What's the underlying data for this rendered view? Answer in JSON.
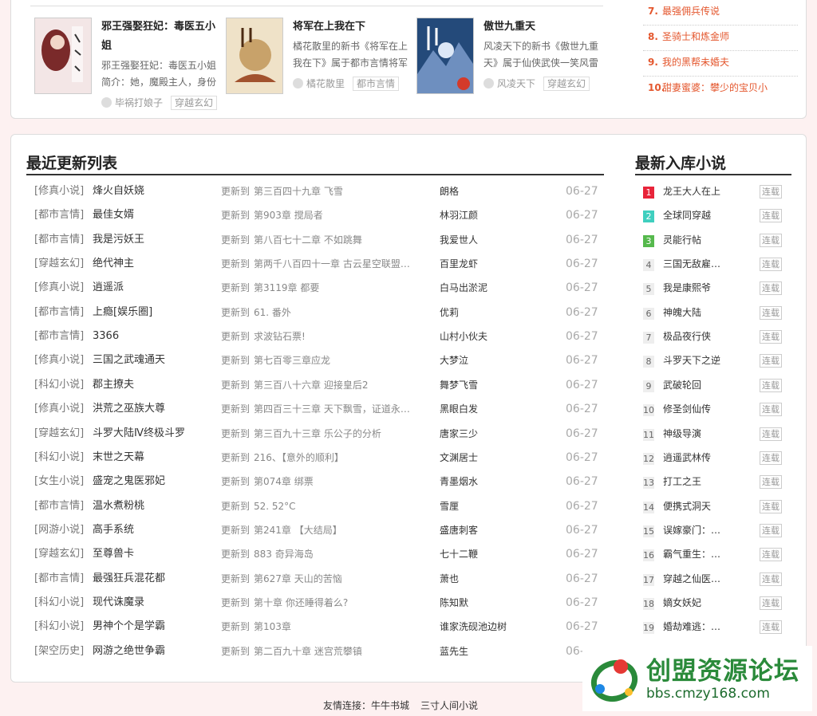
{
  "featured_books": [
    {
      "title": "邪王强娶狂妃：毒医五小姐",
      "desc": "邪王强娶狂妃：毒医五小姐简介：她，魔殿主人，身份",
      "author": "毕祸打娘子",
      "tag": "穿越玄幻"
    },
    {
      "title": "将军在上我在下",
      "desc": "橘花散里的新书《将军在上我在下》属于都市言情将军",
      "author": "橘花散里",
      "tag": "都市言情"
    },
    {
      "title": "傲世九重天",
      "desc": "风凌天下的新书《傲世九重天》属于仙侠武侠一笑风雷",
      "author": "风凌天下",
      "tag": "穿越玄幻"
    }
  ],
  "ranking": [
    {
      "num": "7.",
      "title": "最强佣兵传说"
    },
    {
      "num": "8.",
      "title": "圣骑士和炼金师"
    },
    {
      "num": "9.",
      "title": "我的黑帮未婚夫"
    },
    {
      "num": "10.",
      "title": "甜妻蜜婆：攀少的宝贝小"
    }
  ],
  "recent": {
    "heading": "最近更新列表",
    "update_label": "更新到",
    "rows": [
      {
        "cat": "[修真小说]",
        "book": "烽火自妖娆",
        "chapter": "第三百四十九章 飞雪",
        "author": "朗格",
        "date": "06-27"
      },
      {
        "cat": "[都市言情]",
        "book": "最佳女婿",
        "chapter": "第903章 搅局者",
        "author": "林羽江颜",
        "date": "06-27"
      },
      {
        "cat": "[都市言情]",
        "book": "我是污妖王",
        "chapter": "第八百七十二章 不如跳舞",
        "author": "我爱世人",
        "date": "06-27"
      },
      {
        "cat": "[穿越玄幻]",
        "book": "绝代神主",
        "chapter": "第两千八百四十一章 古云星空联盟…",
        "author": "百里龙虾",
        "date": "06-27"
      },
      {
        "cat": "[修真小说]",
        "book": "逍遥派",
        "chapter": "第3119章 都要",
        "author": "白马出淤泥",
        "date": "06-27"
      },
      {
        "cat": "[都市言情]",
        "book": "上瘾[娱乐圈]",
        "chapter": "61. 番外",
        "author": "优莉",
        "date": "06-27"
      },
      {
        "cat": "[都市言情]",
        "book": "3366",
        "chapter": "求波钻石票!",
        "author": "山村小伙夫",
        "date": "06-27"
      },
      {
        "cat": "[修真小说]",
        "book": "三国之武魂通天",
        "chapter": "第七百零三章应龙",
        "author": "大梦泣",
        "date": "06-27"
      },
      {
        "cat": "[科幻小说]",
        "book": "郡主撩夫",
        "chapter": "第三百八十六章 迎接皇后2",
        "author": "舞梦飞雪",
        "date": "06-27"
      },
      {
        "cat": "[修真小说]",
        "book": "洪荒之巫族大尊",
        "chapter": "第四百三十三章 天下飘雪，证道永…",
        "author": "黑眼白发",
        "date": "06-27"
      },
      {
        "cat": "[穿越玄幻]",
        "book": "斗罗大陆Ⅳ终极斗罗",
        "chapter": "第三百九十三章 乐公子的分析",
        "author": "唐家三少",
        "date": "06-27"
      },
      {
        "cat": "[科幻小说]",
        "book": "末世之天幕",
        "chapter": "216、【意外的顺利】",
        "author": "文渊居士",
        "date": "06-27"
      },
      {
        "cat": "[女生小说]",
        "book": "盛宠之鬼医邪妃",
        "chapter": "第074章 绑票",
        "author": "青墨烟水",
        "date": "06-27"
      },
      {
        "cat": "[都市言情]",
        "book": "温水煮粉桃",
        "chapter": "52. 52°C",
        "author": "雪厘",
        "date": "06-27"
      },
      {
        "cat": "[网游小说]",
        "book": "高手系统",
        "chapter": "第241章 【大结局】",
        "author": "盛唐刺客",
        "date": "06-27"
      },
      {
        "cat": "[穿越玄幻]",
        "book": "至尊兽卡",
        "chapter": "883 奇异海岛",
        "author": "七十二鞭",
        "date": "06-27"
      },
      {
        "cat": "[都市言情]",
        "book": "最强狂兵混花都",
        "chapter": "第627章 天山的苦恼",
        "author": "萧也",
        "date": "06-27"
      },
      {
        "cat": "[科幻小说]",
        "book": "现代诛魔录",
        "chapter": "第十章 你还睡得着么?",
        "author": "陈知默",
        "date": "06-27"
      },
      {
        "cat": "[科幻小说]",
        "book": "男神个个是学霸",
        "chapter": "第103章",
        "author": "谁家洗砚池边树",
        "date": "06-27"
      },
      {
        "cat": "[架空历史]",
        "book": "网游之绝世争霸",
        "chapter": "第二百九十章 迷宫荒攀镇",
        "author": "蓝先生",
        "date": "06-"
      }
    ]
  },
  "new_books": {
    "heading": "最新入库小说",
    "status": "连载",
    "items": [
      {
        "num": "1",
        "title": "龙王大人在上"
      },
      {
        "num": "2",
        "title": "全球同穿越"
      },
      {
        "num": "3",
        "title": "灵能行帖"
      },
      {
        "num": "4",
        "title": "三国无敌雇…"
      },
      {
        "num": "5",
        "title": "我是康熙爷"
      },
      {
        "num": "6",
        "title": "神魄大陆"
      },
      {
        "num": "7",
        "title": "极品夜行侠"
      },
      {
        "num": "8",
        "title": "斗罗天下之逆"
      },
      {
        "num": "9",
        "title": "武破轮回"
      },
      {
        "num": "10",
        "title": "修圣剑仙传"
      },
      {
        "num": "11",
        "title": "神级导演"
      },
      {
        "num": "12",
        "title": "逍遥武林传"
      },
      {
        "num": "13",
        "title": "打工之王"
      },
      {
        "num": "14",
        "title": "便携式洞天"
      },
      {
        "num": "15",
        "title": "误嫁豪门：…"
      },
      {
        "num": "16",
        "title": "霸气重生：…"
      },
      {
        "num": "17",
        "title": "穿越之仙医…"
      },
      {
        "num": "18",
        "title": "嫡女妖妃"
      },
      {
        "num": "19",
        "title": "婚劫难逃：…"
      }
    ]
  },
  "friends": {
    "label": "友情连接：",
    "links": [
      "牛牛书城",
      "三寸人间小说"
    ]
  },
  "watermark": {
    "title": "创盟资源论坛",
    "url": "bbs.cmzy168.com"
  }
}
